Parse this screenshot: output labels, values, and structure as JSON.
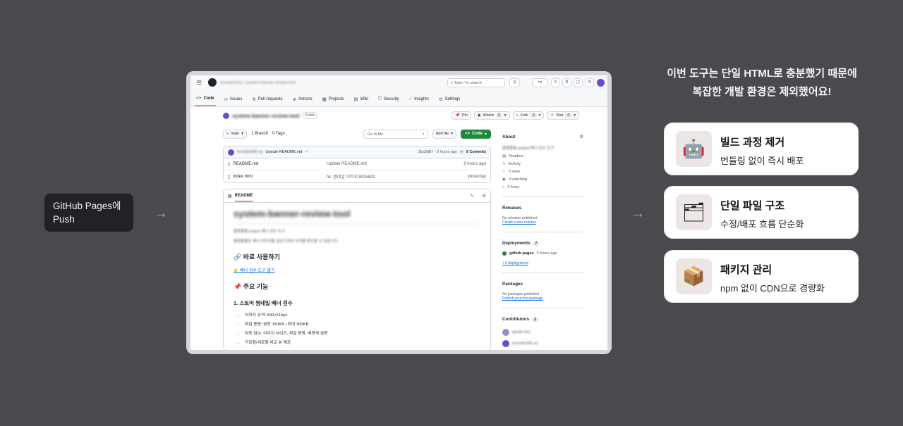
{
  "left_label": {
    "line1": "GitHub Pages에",
    "line2": "Push"
  },
  "arrows": {
    "left": "→",
    "right": "→"
  },
  "header": {
    "repo_crumb": "bcrealm345 / system-banner-review-tool",
    "search_placeholder": "Type / to search",
    "tabs": [
      {
        "label": "Code"
      },
      {
        "label": "Issues"
      },
      {
        "label": "Pull requests"
      },
      {
        "label": "Actions"
      },
      {
        "label": "Projects"
      },
      {
        "label": "Wiki"
      },
      {
        "label": "Security"
      },
      {
        "label": "Insights"
      },
      {
        "label": "Settings"
      }
    ]
  },
  "repo": {
    "name": "system-banner-review-tool",
    "visibility": "Public",
    "pin": "Pin",
    "watch": "Watch",
    "watch_count": "0",
    "fork": "Fork",
    "fork_count": "0",
    "star": "Star",
    "star_count": "0"
  },
  "toolbar": {
    "branch": "main",
    "branches": "1 Branch",
    "tags": "0 Tags",
    "goto": "Go to file",
    "goto_key": "t",
    "add_file": "Add file",
    "code": "Code"
  },
  "commit": {
    "user": "bcrealm345-ay",
    "message": "Update README.md",
    "meta": "3ba3d87 · 9 hours ago",
    "commits": "6 Commits"
  },
  "files": [
    {
      "name": "README.md",
      "message": "Update README.md",
      "when": "9 hours ago"
    },
    {
      "name": "index.html",
      "message": "fix: 썸네일 이미지 800x800",
      "when": "yesterday"
    }
  ],
  "readme": {
    "tab": "README",
    "title": "system-banner-review-tool",
    "blur1": "플랫폼별 project 배너 검수 도구",
    "blur2": "플랫폼별로 배너 이미지를 업로드하여 규격을 확인할 수 있습니다.",
    "h_use": "🔗 바로 사용하기",
    "link": "👉 배너 검수 도구 열기",
    "h_features": "📌 주요 기능",
    "h_store": "1. 스토어 썸네일 배너 검수",
    "items": [
      "이미지 규격: 690×516px",
      "파일 용량: 권장 150KB / 최대 300KB",
      "자동 검수: 이미지 사이즈, 파일 용량, 배경색 검증",
      "가로형/세로형 비교 뷰 제공"
    ]
  },
  "sidebar": {
    "about": "About",
    "description": "플랫폼별 project 배너 검수 도구",
    "links": [
      "Readme",
      "Activity",
      "0 stars",
      "0 watching",
      "0 forks"
    ],
    "releases": "Releases",
    "no_releases": "No releases published",
    "create_release": "Create a new release",
    "deployments": "Deployments",
    "deployments_count": "7",
    "dep_name": "github-pages",
    "dep_when": "9 hours ago",
    "more_deps": "+ 6 deployments",
    "packages": "Packages",
    "no_packages": "No packages published",
    "publish_pkg": "Publish your first package",
    "contributors": "Contributors",
    "contributors_count": "2",
    "contrib1": "pixelm-bot",
    "contrib2": "bcrealm345-ay"
  },
  "right_title": {
    "line1": "이번 도구는 단일 HTML로 충분했기 때문에",
    "line2": "복잡한 개발 환경은 제외했어요!"
  },
  "cards": [
    {
      "title": "빌드 과정 제거",
      "subtitle": "번들링 없이 즉시 배포",
      "icon": "robot-icon"
    },
    {
      "title": "단일 파일 구조",
      "subtitle": "수정/배포 흐름 단순화",
      "icon": "file-box-icon"
    },
    {
      "title": "패키지 관리",
      "subtitle": "npm 없이 CDN으로 경량화",
      "icon": "package-icon"
    }
  ]
}
